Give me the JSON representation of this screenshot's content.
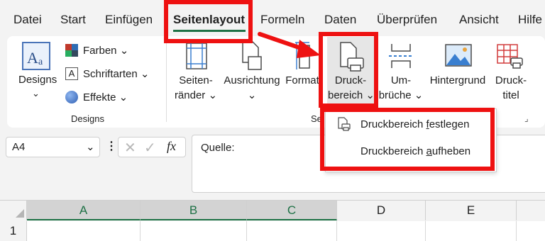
{
  "tabs": [
    "Datei",
    "Start",
    "Einfügen",
    "Seitenlayout",
    "Formeln",
    "Daten",
    "Überprüfen",
    "Ansicht",
    "Hilfe"
  ],
  "designs": {
    "designs_label": "Designs",
    "farben": "Farben",
    "schriftarten": "Schriftarten",
    "effekte": "Effekte",
    "group_label": "Designs"
  },
  "page_setup": {
    "seitenraender_1": "Seiten-",
    "seitenraender_2": "ränder",
    "ausrichtung": "Ausrichtung",
    "format": "Format",
    "druckbereich_1": "Druck-",
    "druckbereich_2": "bereich",
    "umbrueche_1": "Um-",
    "umbrueche_2": "brüche",
    "hintergrund": "Hintergrund",
    "drucktitel_1": "Druck-",
    "drucktitel_2": "titel",
    "group_label_partial": "Sei"
  },
  "dropdown": {
    "item1_pre": "Druckbereich ",
    "item1_u": "f",
    "item1_post": "estlegen",
    "item2_pre": "Druckbereich ",
    "item2_u": "a",
    "item2_post": "ufheben"
  },
  "formula_bar": {
    "name_box": "A4",
    "fx": "fx",
    "content": "Quelle:"
  },
  "grid": {
    "columns": [
      "A",
      "B",
      "C",
      "D",
      "E"
    ],
    "row1": "1"
  },
  "colors": {
    "accent_green": "#1e7145",
    "highlight_red": "#ee1111"
  }
}
